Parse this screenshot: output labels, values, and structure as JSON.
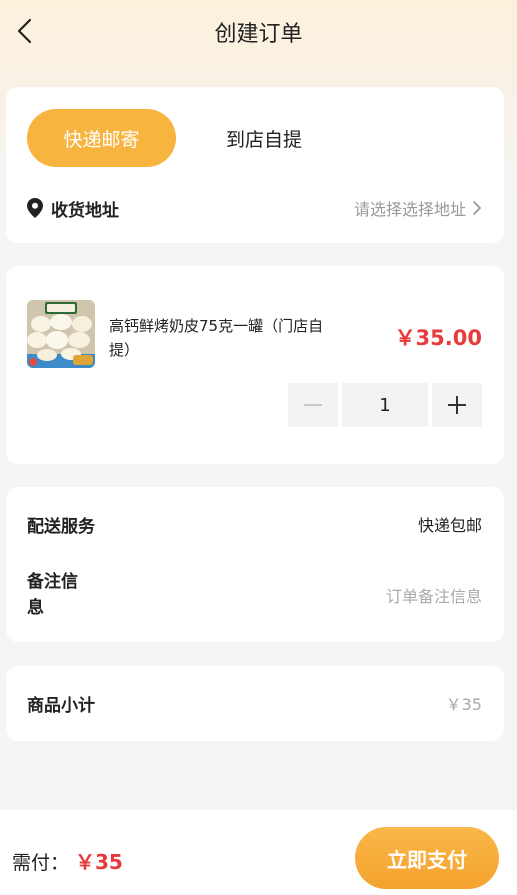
{
  "header": {
    "title": "创建订单",
    "back_icon": "chevron-left-icon"
  },
  "delivery": {
    "tabs": [
      {
        "label": "快递邮寄",
        "active": true
      },
      {
        "label": "到店自提",
        "active": false
      }
    ],
    "address_label": "收货地址",
    "address_placeholder": "请选择选择地址"
  },
  "product": {
    "name": "高钙鲜烤奶皮75克一罐（门店自提）",
    "price": "￥35.00",
    "quantity": "1"
  },
  "service": {
    "shipping_label": "配送服务",
    "shipping_value": "快递包邮",
    "remark_label": "备注信息",
    "remark_placeholder": "订单备注信息"
  },
  "subtotal": {
    "label": "商品小计",
    "value": "￥35"
  },
  "footer": {
    "need_pay_label": "需付：",
    "need_pay_amount": "￥35",
    "pay_button": "立即支付"
  },
  "colors": {
    "accent": "#f7b43f",
    "price_red": "#e83a3a"
  }
}
